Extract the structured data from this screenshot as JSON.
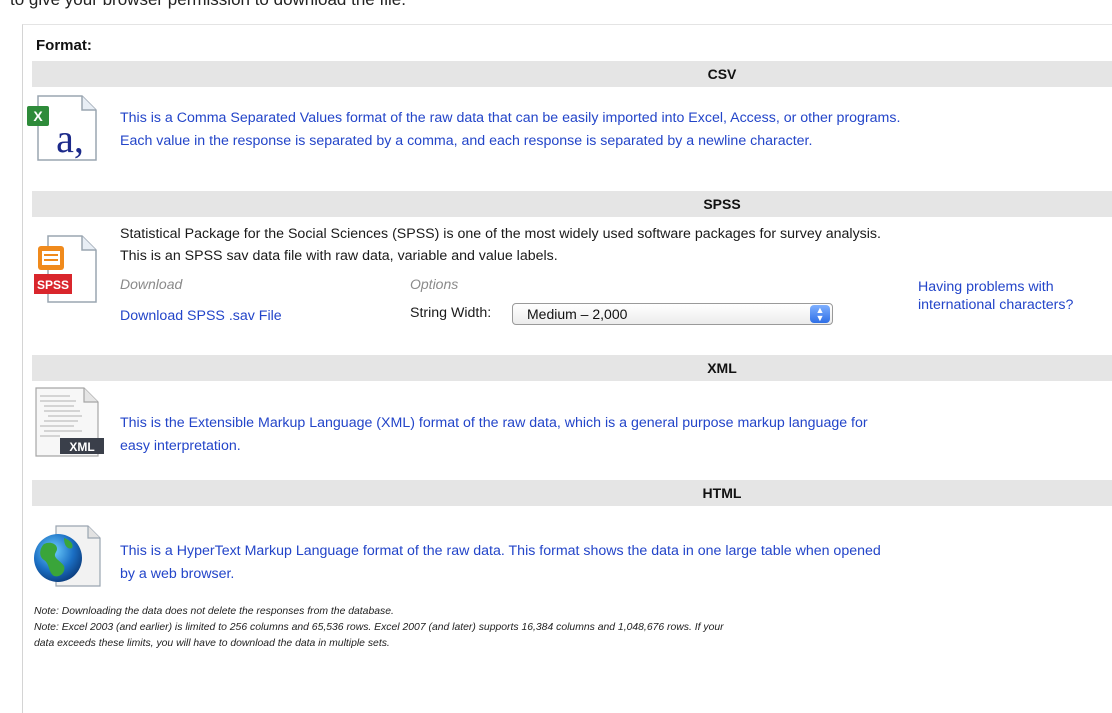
{
  "intro_text": "to give your browser permission to download the file.",
  "format_label": "Format:",
  "sections": {
    "csv": {
      "title": "CSV",
      "line1": "This is a Comma Separated Values format of the raw data that can be easily imported into Excel, Access, or other programs.",
      "line2": "Each value in the response is  separated by a comma, and each response is separated by a newline character."
    },
    "spss": {
      "title": "SPSS",
      "line1": "Statistical Package for the Social Sciences (SPSS) is one of the most widely used software packages for survey analysis.",
      "line2": "This is an SPSS sav data file with raw data, variable and value labels.",
      "download_label": "Download",
      "download_link": "Download SPSS .sav File",
      "options_label": "Options",
      "string_width_label": "String Width:",
      "string_width_value": "Medium – 2,000",
      "help_line1": "Having problems with",
      "help_line2": "international characters?",
      "icon_text": "SPSS"
    },
    "xml": {
      "title": "XML",
      "line1": "This is the Extensible Markup Language (XML) format of the raw data, which is a general purpose markup language for",
      "line2": "easy interpretation.",
      "icon_text": "XML"
    },
    "html": {
      "title": "HTML",
      "line1": "This is a HyperText Markup Language format of the raw data. This format shows the data in one large table when opened",
      "line2": "by a web browser."
    }
  },
  "notes": {
    "line1": "Note: Downloading the data does not delete the responses from the database.",
    "line2": "Note: Excel 2003 (and earlier) is limited to 256 columns and 65,536 rows. Excel 2007 (and later) supports 16,384 columns and 1,048,676 rows. If your",
    "line3": "data exceeds these limits, you will have to download the data  in multiple sets."
  },
  "colors": {
    "link_blue": "#2345c9",
    "section_bar": "#e5e5e5",
    "spss_red": "#d9262c",
    "excel_green": "#2e8b3a"
  },
  "icons": {
    "csv": "excel-csv-file-icon",
    "spss": "spss-file-icon",
    "xml": "xml-file-icon",
    "html": "html-globe-file-icon",
    "select_arrow": "select-arrows-icon"
  }
}
